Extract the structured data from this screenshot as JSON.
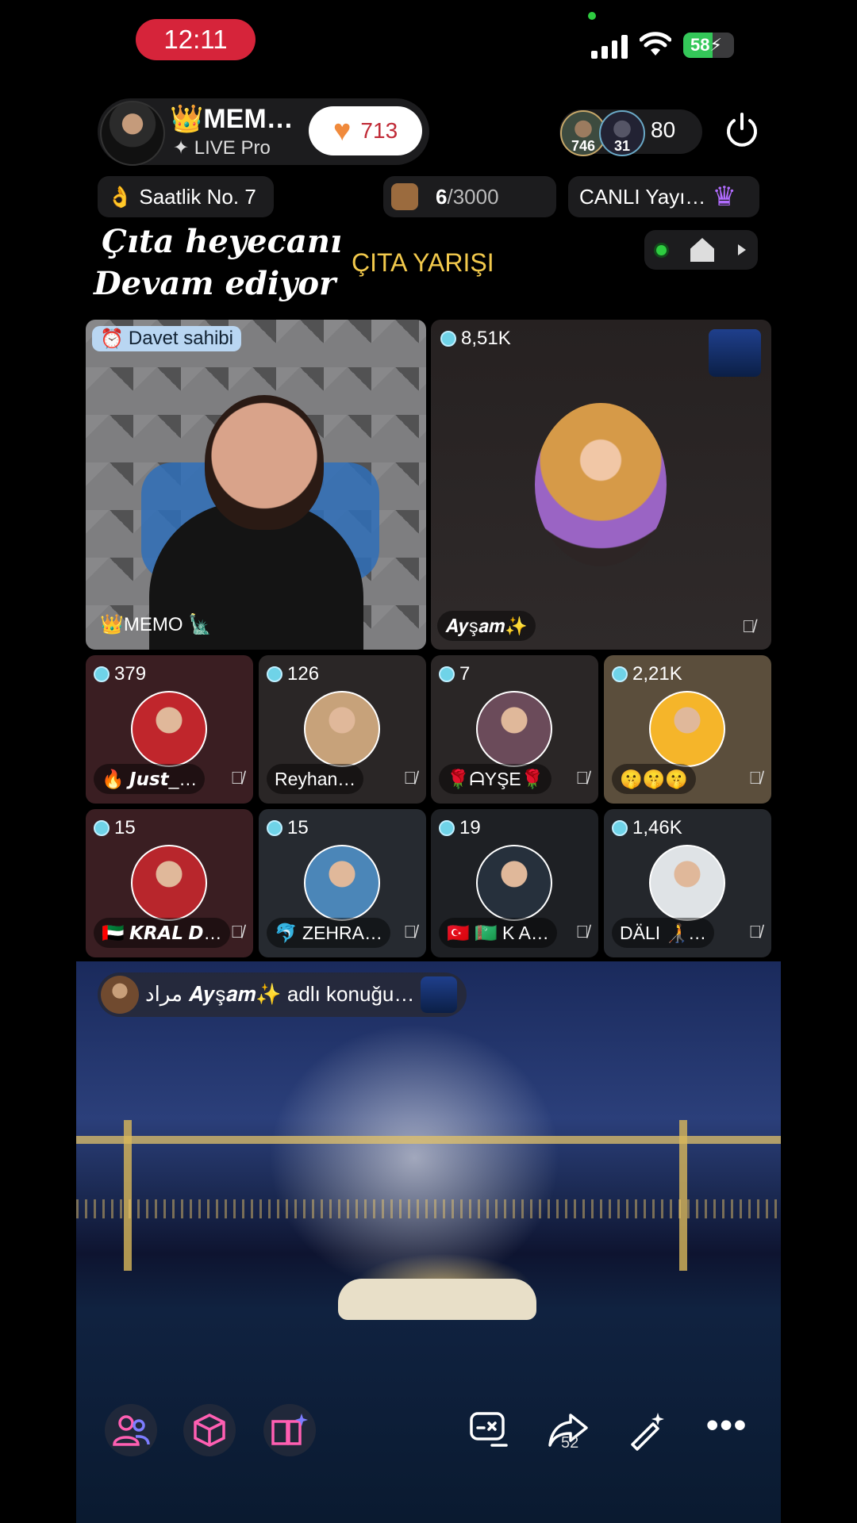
{
  "status_bar": {
    "time": "12:11",
    "battery": "58",
    "battery_level_percent": 58
  },
  "host": {
    "name": "MEM…",
    "crown": "👑",
    "subtitle": "LIVE Pro",
    "likes": "713"
  },
  "viewers": {
    "avatar_1_badge": "746",
    "avatar_2_badge": "31",
    "count": "80"
  },
  "chips": {
    "hourly_icon": "👌",
    "hourly": "Saatlik No. 7",
    "goal_current": "6",
    "goal_total": "/3000",
    "canli": "CANLI Yayı…"
  },
  "banner": {
    "line1": "Çıta heyecanı",
    "line2": "Devam ediyor",
    "race_title": "ÇITA YARIŞI"
  },
  "main_tiles": {
    "host_tile": {
      "badge": "Davet sahibi",
      "name": "👑MEMO 🗽"
    },
    "guest_tile": {
      "count": "8,51K",
      "name": "𝑨𝒚ş𝒂𝒎✨"
    }
  },
  "guests": [
    {
      "count": "379",
      "name": "🔥 𝙅𝙪𝙨𝙩_…",
      "bg": "#3a1e22",
      "avatar_color": "#c0262c"
    },
    {
      "count": "126",
      "name": "Reyhan…",
      "bg": "#2a2626",
      "avatar_color": "#c7a27a"
    },
    {
      "count": "7",
      "name": "🌹ᗩYŞE🌹",
      "bg": "#2a2626",
      "avatar_color": "#6b4b5a"
    },
    {
      "count": "2,21K",
      "name": "🤫🤫🤫",
      "bg": "#5b4e3c",
      "avatar_color": "#f5b52a"
    },
    {
      "count": "15",
      "name": "🇦🇪 𝙆𝙍𝘼𝙇 𝘿…",
      "bg": "#3a1e22",
      "avatar_color": "#b8262c"
    },
    {
      "count": "15",
      "name": "🐬 ZEHRA…",
      "bg": "#262a30",
      "avatar_color": "#4b86b8"
    },
    {
      "count": "19",
      "name": "🇹🇷 🇹🇲 K A…",
      "bg": "#1e2024",
      "avatar_color": "#26303c"
    },
    {
      "count": "1,46K",
      "name": "DÄLI 🧑‍🦯…",
      "bg": "#24272c",
      "avatar_color": "#dfe3e6"
    }
  ],
  "notification": {
    "text": "مراد 𝑨𝒚ş𝒂𝒎✨ adlı konuğu…"
  },
  "toolbar": {
    "share_count": "52",
    "more": "•••"
  },
  "colors": {
    "accent_pink": "#ff5fb2",
    "accent_gold": "#f2c94c",
    "live_red": "#d6243a",
    "battery_green": "#34c759"
  }
}
